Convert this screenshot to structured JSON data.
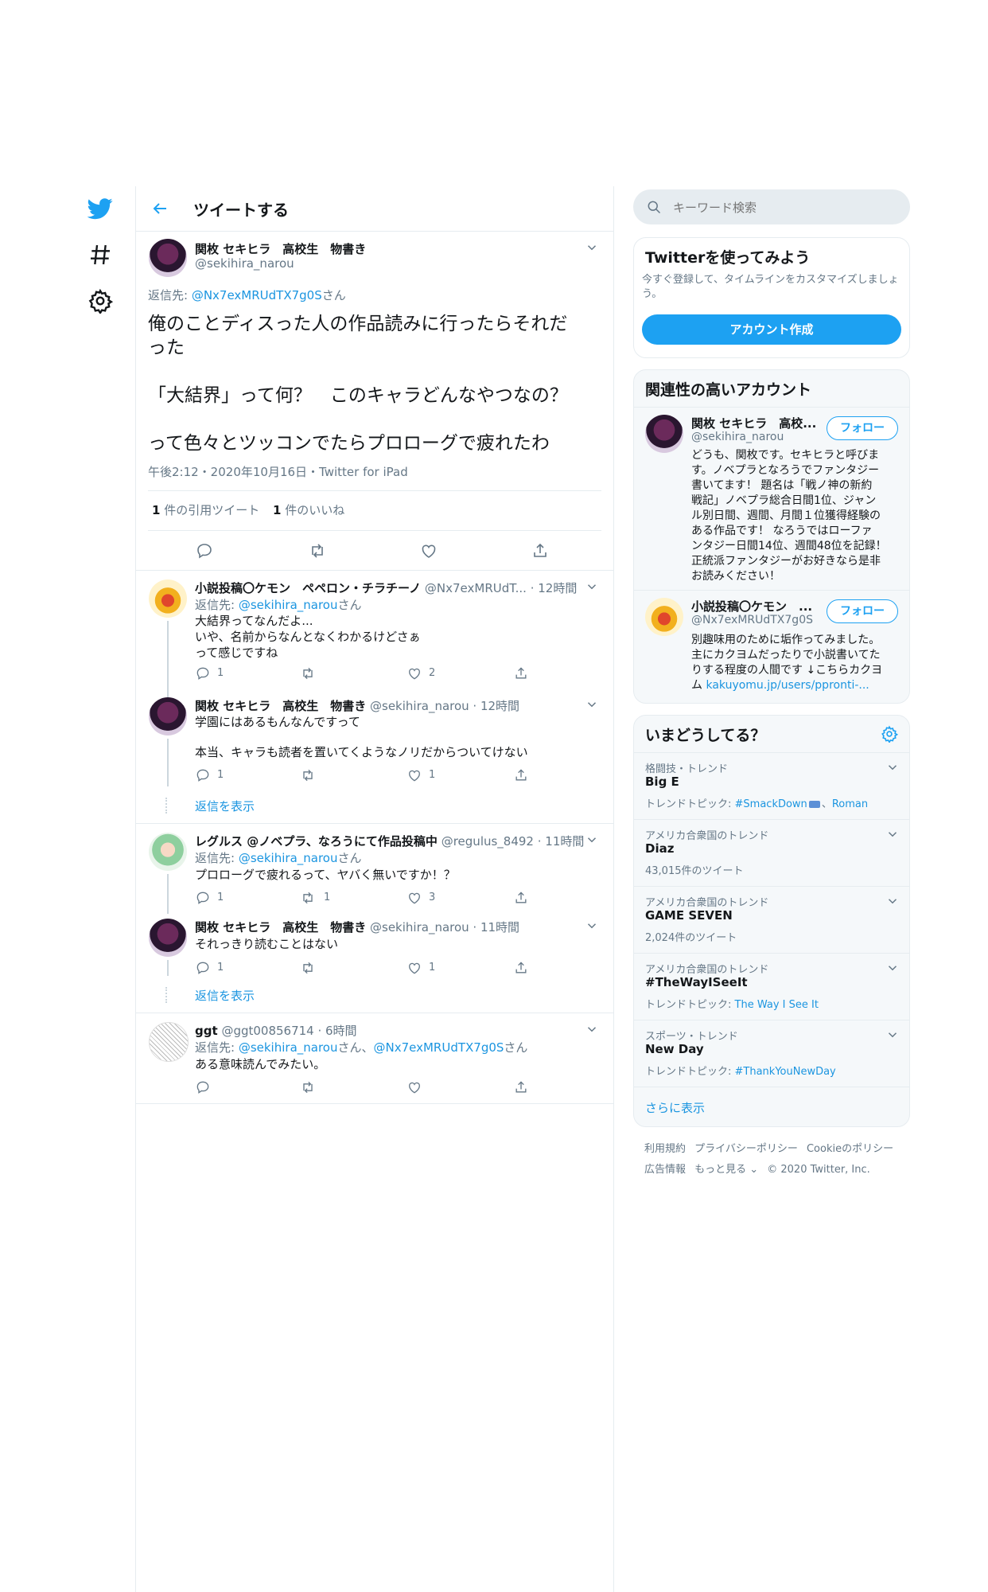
{
  "nav": {
    "icons": [
      "twitter-logo-icon",
      "hashtag-icon",
      "gear-icon"
    ]
  },
  "header": {
    "title": "ツイートする"
  },
  "main_tweet": {
    "name": "関枚 セキヒラ　高校生　物書き",
    "handle": "@sekihira_narou",
    "reply_prefix": "返信先: ",
    "reply_to": "@Nx7exMRUdTX7g0S",
    "reply_suffix": "さん",
    "text_line1": "俺のことディスった人の作品読みに行ったらそれだ",
    "text_line2": "った",
    "text_line3": "「大結界」って何？　このキャラどんなやつなの？",
    "text_line4": "って色々とツッコンでたらプロローグで疲れたわ",
    "meta": "午後2:12・2020年10月16日・Twitter for iPad",
    "quote_count": "1",
    "quote_label": "件の引用ツイート",
    "like_count": "1",
    "like_label": "件のいいね"
  },
  "replies": [
    {
      "name": "小説投稿〇ケモン　ペペロン・チラチーノ",
      "handle_time": "@Nx7exMRUdT... · 12時間",
      "reply_prefix": "返信先: ",
      "reply_to": "@sekihira_narou",
      "reply_suffix": "さん",
      "line1": "大結界ってなんだよ...",
      "line2": "いや、名前からなんとなくわかるけどさぁ",
      "line3": "って感じですね",
      "reply_count": "1",
      "retweet_count": "",
      "like_count": "2"
    },
    {
      "name": "関枚 セキヒラ　高校生　物書き",
      "handle_time": "@sekihira_narou · 12時間",
      "line1": "学園にはあるもんなんですって",
      "line2": "本当、キャラも読者を置いてくようなノリだからついてけない",
      "reply_count": "1",
      "retweet_count": "",
      "like_count": "1",
      "show_replies": "返信を表示"
    },
    {
      "name": "レグルス @ノベプラ、なろうにて作品投稿中",
      "handle_time": "@regulus_8492 · 11時間",
      "reply_prefix": "返信先: ",
      "reply_to": "@sekihira_narou",
      "reply_suffix": "さん",
      "line1": "プロローグで疲れるって、ヤバく無いですか！？",
      "reply_count": "1",
      "retweet_count": "1",
      "like_count": "3"
    },
    {
      "name": "関枚 セキヒラ　高校生　物書き",
      "handle_time": "@sekihira_narou · 11時間",
      "line1": "それっきり読むことはない",
      "reply_count": "1",
      "retweet_count": "",
      "like_count": "1",
      "show_replies": "返信を表示"
    },
    {
      "name": "ggt",
      "handle_time": "@ggt00856714 · 6時間",
      "reply_prefix": "返信先: ",
      "reply_to": "@sekihira_narou",
      "reply_mid": "さん、",
      "reply_to2": "@Nx7exMRUdTX7g0S",
      "reply_suffix": "さん",
      "line1": "ある意味読んでみたい。",
      "reply_count": "",
      "retweet_count": "",
      "like_count": ""
    }
  ],
  "search": {
    "placeholder": "キーワード検索"
  },
  "signup": {
    "title": "Twitterを使ってみよう",
    "desc_line1": "今すぐ登録して、タイムラインをカスタマイズしましょ",
    "desc_line2": "う。",
    "button": "アカウント作成"
  },
  "related": {
    "title": "関連性の高いアカウント",
    "accounts": [
      {
        "name": "関枚 セキヒラ　高校...",
        "handle": "@sekihira_narou",
        "follow": "フォロー",
        "bio": [
          "どうも、関枚です。セキヒラと呼びま",
          "す。ノベプラとなろうでファンタジー",
          "書いてます！ 題名は「戦ノ神の新約",
          "戦記」ノベプラ総合日間1位、ジャン",
          "ル別日間、週間、月間１位獲得経験の",
          "ある作品です！ なろうではローファ",
          "ンタジー日間14位、週間48位を記録！",
          "正統派ファンタジーがお好きなら是非",
          "お読みください！"
        ]
      },
      {
        "name": "小説投稿〇ケモン　...",
        "handle": "@Nx7exMRUdTX7g0S",
        "follow": "フォロー",
        "bio": [
          "別趣味用のために垢作ってみました。",
          "主にカクヨムだったりで小説書いてた",
          "りする程度の人間です ↓こちらカクヨ"
        ],
        "bio_last_prefix": "ム ",
        "bio_link": "kakuyomu.jp/users/pprontі-..."
      }
    ]
  },
  "trends": {
    "title": "いまどうしてる？",
    "items": [
      {
        "category": "格闘技・トレンド",
        "name": "Big E",
        "meta_prefix": "トレンドトピック: ",
        "meta_link": "#SmackDown",
        "meta_mid": "、",
        "meta_link2": "Roman"
      },
      {
        "category": "アメリカ合衆国のトレンド",
        "name": "Diaz",
        "meta": "43,015件のツイート"
      },
      {
        "category": "アメリカ合衆国のトレンド",
        "name": "GAME SEVEN",
        "meta": "2,024件のツイート"
      },
      {
        "category": "アメリカ合衆国のトレンド",
        "name": "#TheWayISeeIt",
        "meta_prefix": "トレンドトピック: ",
        "meta_link": "The Way I See It"
      },
      {
        "category": "スポーツ・トレンド",
        "name": "New Day",
        "meta_prefix": "トレンドトピック: ",
        "meta_link": "#ThankYouNewDay"
      }
    ],
    "show_more": "さらに表示"
  },
  "footer": {
    "line1": [
      "利用規約",
      "プライバシーポリシー",
      "Cookieのポリシー"
    ],
    "ads": "広告情報",
    "more": "もっと見る",
    "copyright": "© 2020 Twitter, Inc."
  }
}
